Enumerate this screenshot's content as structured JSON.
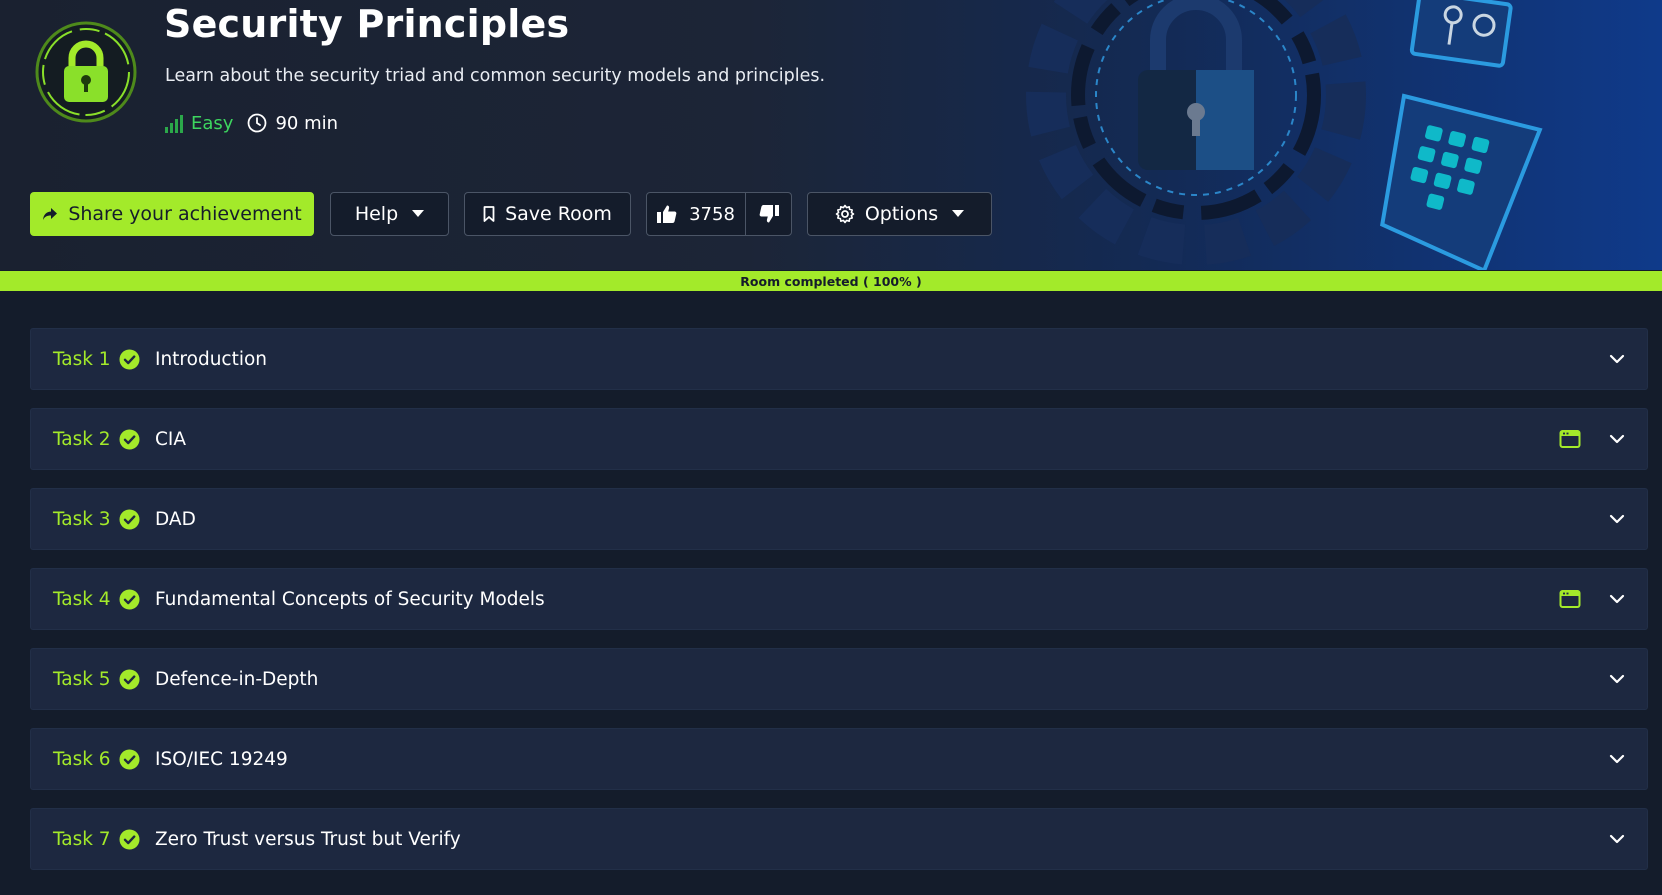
{
  "room": {
    "title": "Security Principles",
    "description": "Learn about the security triad and common security models and principles.",
    "difficulty": "Easy",
    "duration": "90 min",
    "icon": "padlock-icon",
    "banner_art": [
      "padlock-icon",
      "keys-icon",
      "keypad-icon",
      "gear-icon"
    ]
  },
  "actions": {
    "share_label": "Share your achievement",
    "help_label": "Help",
    "save_label": "Save Room",
    "upvotes": "3758",
    "options_label": "Options"
  },
  "progress": {
    "label": "Room completed ( 100% )",
    "value": 1.0
  },
  "tasks": [
    {
      "number": "Task 1",
      "title": "Introduction",
      "completed": true,
      "machine": false
    },
    {
      "number": "Task 2",
      "title": "CIA",
      "completed": true,
      "machine": true
    },
    {
      "number": "Task 3",
      "title": "DAD",
      "completed": true,
      "machine": false
    },
    {
      "number": "Task 4",
      "title": "Fundamental Concepts of Security Models",
      "completed": true,
      "machine": true
    },
    {
      "number": "Task 5",
      "title": "Defence-in-Depth",
      "completed": true,
      "machine": false
    },
    {
      "number": "Task 6",
      "title": "ISO/IEC 19249",
      "completed": true,
      "machine": false
    },
    {
      "number": "Task 7",
      "title": "Zero Trust versus Trust but Verify",
      "completed": true,
      "machine": false
    }
  ],
  "colors": {
    "accent": "#a3ea2a",
    "background": "#141c2b",
    "card": "#1d2840",
    "easy": "#3dd65f"
  }
}
